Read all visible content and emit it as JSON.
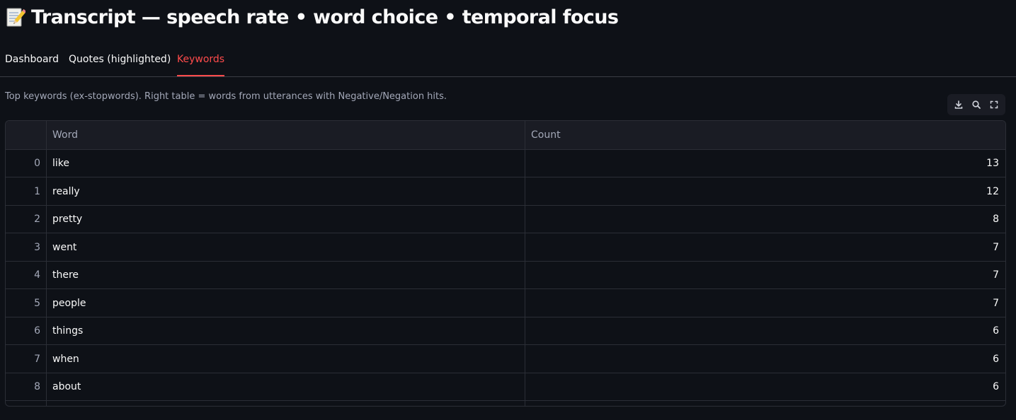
{
  "header": {
    "title": "Transcript — speech rate • word choice • temporal focus",
    "icon": "memo-icon"
  },
  "tabs": [
    {
      "label": "Dashboard",
      "active": false
    },
    {
      "label": "Quotes (highlighted)",
      "active": false
    },
    {
      "label": "Keywords",
      "active": true
    }
  ],
  "caption": "Top keywords (ex-stopwords). Right table = words from utterances with Negative/Negation hits.",
  "toolbar": {
    "icons": [
      "download-icon",
      "search-icon",
      "fullscreen-icon"
    ]
  },
  "table": {
    "columns": [
      "",
      "Word",
      "Count"
    ],
    "rows": [
      {
        "index": "0",
        "word": "like",
        "count": "13"
      },
      {
        "index": "1",
        "word": "really",
        "count": "12"
      },
      {
        "index": "2",
        "word": "pretty",
        "count": "8"
      },
      {
        "index": "3",
        "word": "went",
        "count": "7"
      },
      {
        "index": "4",
        "word": "there",
        "count": "7"
      },
      {
        "index": "5",
        "word": "people",
        "count": "7"
      },
      {
        "index": "6",
        "word": "things",
        "count": "6"
      },
      {
        "index": "7",
        "word": "when",
        "count": "6"
      },
      {
        "index": "8",
        "word": "about",
        "count": "6"
      }
    ]
  },
  "colors": {
    "background": "#0e1117",
    "accent": "#ff4b4b",
    "text": "#fafafa",
    "muted": "#a3a8b8",
    "border": "#2b2e36",
    "header_bg": "#1a1c24"
  }
}
